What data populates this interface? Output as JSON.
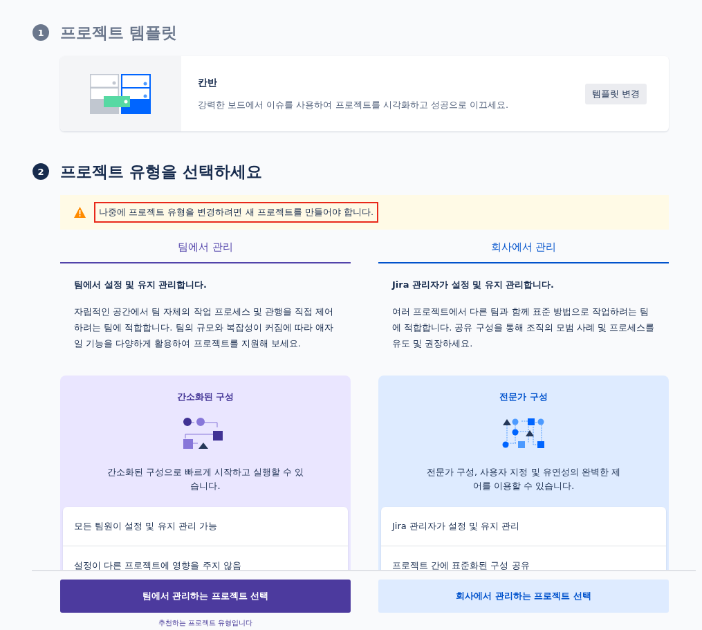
{
  "steps": [
    {
      "number": "1",
      "title": "프로젝트 템플릿",
      "active": false
    },
    {
      "number": "2",
      "title": "프로젝트 유형을 선택하세요",
      "active": true
    }
  ],
  "template": {
    "name": "칸반",
    "description": "강력한 보드에서 이슈를 사용하여 프로젝트를 시각화하고 성공으로 이끄세요.",
    "button": "템플릿 변경"
  },
  "warning": {
    "message": "나중에 프로젝트 유형을 변경하려면 새 프로젝트를 만들어야 합니다.",
    "highlighted": true
  },
  "columns": [
    {
      "kind": "team",
      "tab": "팀에서 관리",
      "heading": "팀에서 설정 및 유지 관리합니다.",
      "description": "자립적인 공간에서 팀 자체의 작업 프로세스 및 관행을 직접 제어하려는 팀에 적합합니다. 팀의 규모와 복잡성이 커짐에 따라 애자일 기능을 다양하게 활용하여 프로젝트를 지원해 보세요.",
      "card_title": "간소화된 구성",
      "card_text": "간소화된 구성으로 빠르게 시작하고 실행할 수 있습니다.",
      "features": [
        "모든 팀원이 설정 및 유지 관리 가능",
        "설정이 다른 프로젝트에 영향을 주지 않음"
      ],
      "button": "팀에서 관리하는 프로젝트 선택",
      "note": "추천하는 프로젝트 유형입니다"
    },
    {
      "kind": "company",
      "tab": "회사에서 관리",
      "heading": "Jira 관리자가 설정 및 유지 관리합니다.",
      "description": "여러 프로젝트에서 다른 팀과 함께 표준 방법으로 작업하려는 팀에 적합합니다. 공유 구성을 통해 조직의 모범 사례 및 프로세스를 유도 및 권장하세요.",
      "card_title": "전문가 구성",
      "card_text": "전문가 구성, 사용자 지정 및 유연성의 완벽한 제어를 이용할 수 있습니다.",
      "features": [
        "Jira 관리자가 설정 및 유지 관리",
        "프로젝트 간에 표준화된 구성 공유"
      ],
      "button": "회사에서 관리하는 프로젝트 선택"
    }
  ]
}
